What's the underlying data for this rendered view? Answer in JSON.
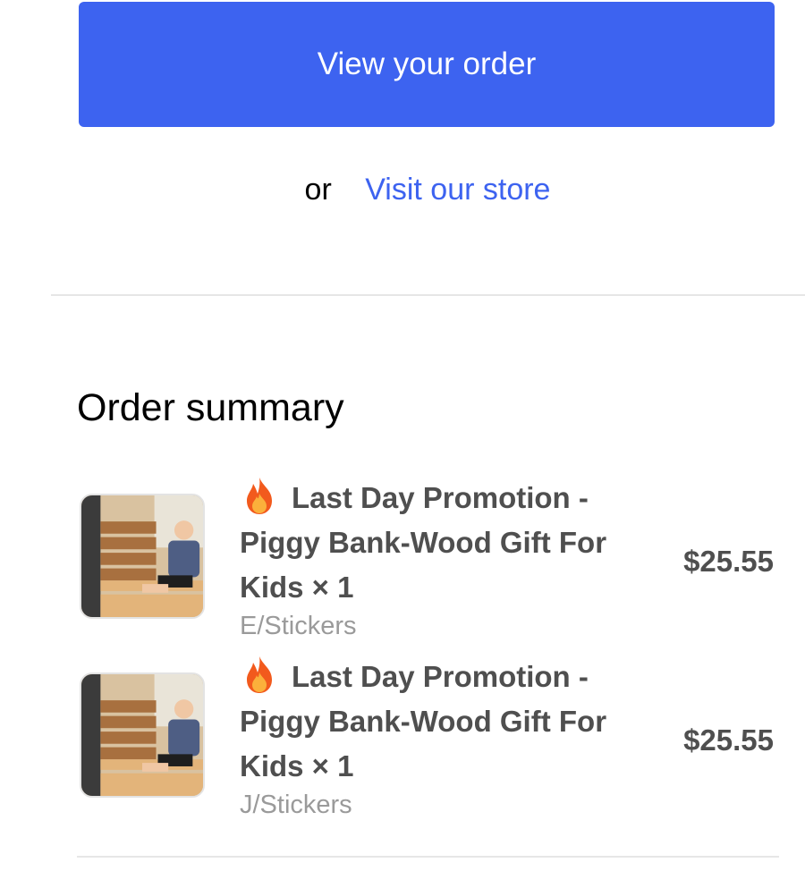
{
  "actions": {
    "view_order_label": "View your order",
    "or_text": "or",
    "visit_store_label": "Visit our store"
  },
  "order_summary": {
    "title": "Order summary",
    "items": [
      {
        "icon": "fire-emoji-icon",
        "title": "Last Day Promotion - Piggy Bank-Wood Gift For Kids × 1",
        "variant": "E/Stickers",
        "price": "$25.55"
      },
      {
        "icon": "fire-emoji-icon",
        "title": "Last Day Promotion - Piggy Bank-Wood Gift For Kids × 1",
        "variant": "J/Stickers",
        "price": "$25.55"
      }
    ]
  },
  "colors": {
    "accent": "#3d63f0",
    "price_text": "#4f4f4f",
    "variant_text": "#9a9a9a",
    "divider": "#e6e6e6"
  }
}
